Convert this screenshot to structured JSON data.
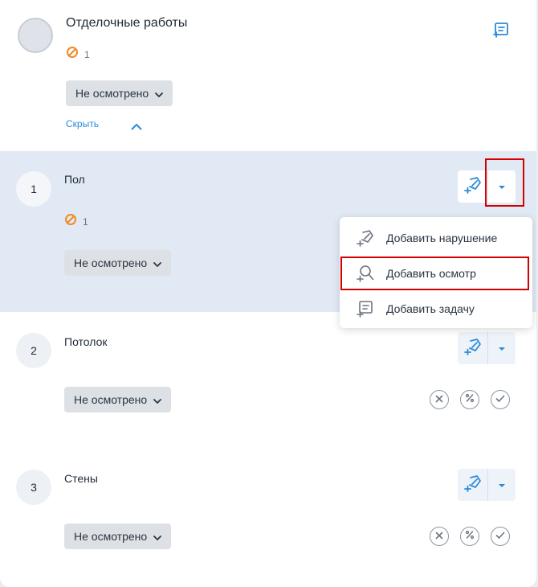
{
  "section": {
    "title": "Отделочные работы",
    "violations_count": "1",
    "status_label": "Не осмотрено",
    "hide_label": "Скрыть"
  },
  "rows": [
    {
      "number": "1",
      "title": "Пол",
      "violations_count": "1",
      "status_label": "Не осмотрено"
    },
    {
      "number": "2",
      "title": "Потолок",
      "status_label": "Не осмотрено"
    },
    {
      "number": "3",
      "title": "Стены",
      "status_label": "Не осмотрено"
    }
  ],
  "dropdown_menu": {
    "items": [
      {
        "label": "Добавить нарушение",
        "icon": "add-violation-icon"
      },
      {
        "label": "Добавить осмотр",
        "icon": "add-inspection-icon"
      },
      {
        "label": "Добавить задачу",
        "icon": "add-task-icon"
      }
    ]
  },
  "colors": {
    "accent": "#2b8bd9",
    "violation": "#f08a24",
    "highlight_border": "#d40000",
    "selected_row_bg": "#e1e9f5"
  }
}
